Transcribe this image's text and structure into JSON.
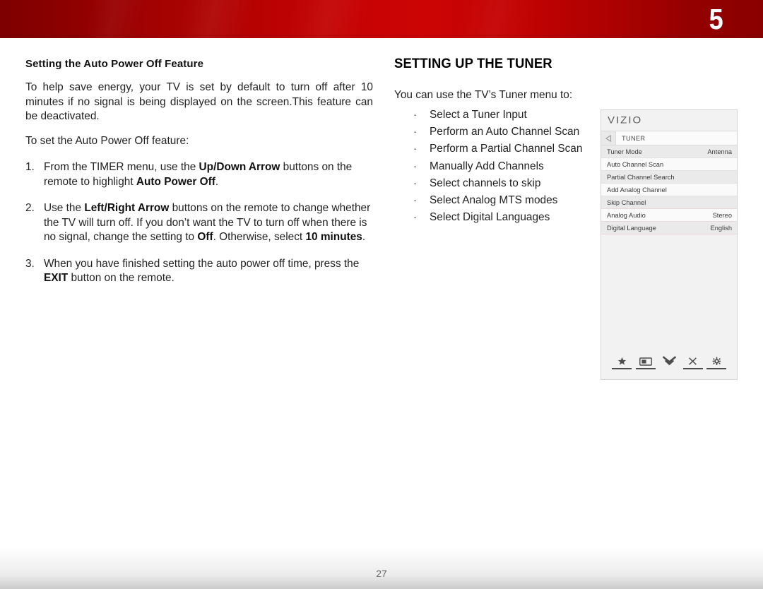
{
  "header": {
    "chapter_number": "5",
    "banner_color_left": "#8a0000",
    "banner_color_mid": "#cc0404",
    "banner_color_right": "#8a0000"
  },
  "left_column": {
    "sub_heading": "Setting the Auto Power Off Feature",
    "paragraph_1_parts": [
      "To help save energy, your TV is set by default to turn off after 10 minutes if no signal is being displayed on the screen.",
      "This feature can be deactivated."
    ],
    "paragraph_2": "To set the Auto Power Off feature:",
    "steps": [
      {
        "number": "1.",
        "parts": [
          {
            "text": "From the TIMER menu, use the ",
            "bold": false
          },
          {
            "text": "Up/Down Arrow",
            "bold": true
          },
          {
            "text": " buttons on the remote to highlight ",
            "bold": false
          },
          {
            "text": "Auto Power Off",
            "bold": true
          },
          {
            "text": ".",
            "bold": false
          }
        ]
      },
      {
        "number": "2.",
        "parts": [
          {
            "text": "Use the ",
            "bold": false
          },
          {
            "text": "Left/Right Arrow",
            "bold": true
          },
          {
            "text": "  buttons on the remote to change whether the TV will turn off. If you don’t want the TV to turn off when there is no signal, change the setting to ",
            "bold": false
          },
          {
            "text": "Off",
            "bold": true
          },
          {
            "text": ". Otherwise, select ",
            "bold": false
          },
          {
            "text": "10 minutes",
            "bold": true
          },
          {
            "text": ".",
            "bold": false
          }
        ]
      },
      {
        "number": "3.",
        "parts": [
          {
            "text": "When you have finished setting the auto power off time, press the ",
            "bold": false
          },
          {
            "text": "EXIT",
            "bold": true
          },
          {
            "text": " button on the remote.",
            "bold": false
          }
        ]
      }
    ]
  },
  "right_column": {
    "section_heading": "SETTING UP THE TUNER",
    "intro": "You can use the TV’s Tuner menu to:",
    "bullet_char": "·",
    "features": [
      "Select a Tuner Input",
      "Perform an Auto Channel Scan",
      "Perform a Partial Channel Scan",
      "Manually Add Channels",
      "Select channels to skip",
      "Select Analog MTS modes",
      "Select Digital Languages"
    ]
  },
  "tv_menu": {
    "brand": "VIZIO",
    "title": "TUNER",
    "back_icon": "back-triangle-icon",
    "rows": [
      {
        "label": "Tuner Mode",
        "value": "Antenna",
        "shade": "alt"
      },
      {
        "label": "Auto Channel Scan",
        "value": "",
        "shade": "plain"
      },
      {
        "label": "Partial Channel Search",
        "value": "",
        "shade": "alt"
      },
      {
        "label": "Add Analog Channel",
        "value": "",
        "shade": "plain"
      },
      {
        "label": "Skip Channel",
        "value": "",
        "shade": "alt"
      },
      {
        "label": "Analog Audio",
        "value": "Stereo",
        "shade": "plain"
      },
      {
        "label": "Digital Language",
        "value": "English",
        "shade": "alt"
      }
    ],
    "icon_bar": [
      {
        "name": "star-icon"
      },
      {
        "name": "picture-mode-icon"
      },
      {
        "name": "double-chevron-down-icon"
      },
      {
        "name": "close-x-icon"
      },
      {
        "name": "gear-icon"
      }
    ]
  },
  "footer": {
    "page_number": "27"
  }
}
